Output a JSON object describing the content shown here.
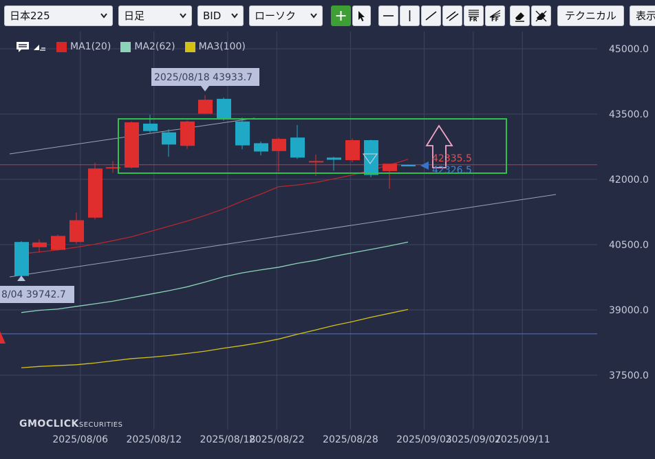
{
  "toolbar": {
    "symbol": "日本225",
    "timeframe": "日足",
    "price_type": "BID",
    "chart_style": "ローソク",
    "technical_label": "テクニカル",
    "display_label": "表示",
    "chevron": "⌄",
    "tool_icons": [
      "crosshair-icon",
      "pointer-icon",
      "horizontal-line-icon",
      "vertical-line-icon",
      "trend-line-icon",
      "parallel-lines-icon",
      "fibonacci-retracement-icon",
      "fibonacci-fan-icon",
      "eraser-icon",
      "eraser-all-icon"
    ],
    "fr_label": "FR",
    "ff_label": "FF",
    "active_tool": "crosshair-icon"
  },
  "legend": {
    "items": [
      {
        "label": "MA1(20)",
        "color": "#d72626"
      },
      {
        "label": "MA2(62)",
        "color": "#8bd4b8"
      },
      {
        "label": "MA3(100)",
        "color": "#d3c215"
      }
    ]
  },
  "brand": {
    "name": "GMOCLICK",
    "suffix": "SECURITIES"
  },
  "colors": {
    "background": "#262b44",
    "grid": "#3e4460",
    "bull": "#e02d2d",
    "bear": "#1fa9c6",
    "rectangle": "#2fc24a",
    "arrow": "#f0a8c8",
    "horizontal_line_red": "#c43a3a",
    "horizontal_line_blue": "#3a74c9",
    "trend_line": "#9ea3b5"
  },
  "chart_data": {
    "type": "candlestick",
    "y_ticks": [
      "45000.0",
      "43500.0",
      "42000.0",
      "40500.0",
      "39000.0",
      "37500.0"
    ],
    "x_ticks": [
      "2025/08/06",
      "2025/08/12",
      "2025/08/18",
      "2025/08/22",
      "2025/08/28",
      "2025/09/03",
      "2025/09/07",
      "2025/09/11"
    ],
    "ylim": [
      36900,
      45650
    ],
    "candles": [
      {
        "date": "2025/08/04",
        "open": 40560,
        "high": 40580,
        "low": 39742.7,
        "close": 39780
      },
      {
        "date": "2025/08/05",
        "open": 40440,
        "high": 40620,
        "low": 40320,
        "close": 40550
      },
      {
        "date": "2025/08/06",
        "open": 40380,
        "high": 40730,
        "low": 40370,
        "close": 40700
      },
      {
        "date": "2025/08/07",
        "open": 40560,
        "high": 41240,
        "low": 40520,
        "close": 41060
      },
      {
        "date": "2025/08/08",
        "open": 41120,
        "high": 42380,
        "low": 41080,
        "close": 42250
      },
      {
        "date": "2025/08/11",
        "open": 42280,
        "high": 42420,
        "low": 42150,
        "close": 42280
      },
      {
        "date": "2025/08/12",
        "open": 42270,
        "high": 43330,
        "low": 42250,
        "close": 43310
      },
      {
        "date": "2025/08/13",
        "open": 43280,
        "high": 43480,
        "low": 43070,
        "close": 43110
      },
      {
        "date": "2025/08/14",
        "open": 43080,
        "high": 43150,
        "low": 42520,
        "close": 42800
      },
      {
        "date": "2025/08/15",
        "open": 42770,
        "high": 43350,
        "low": 42700,
        "close": 43330
      },
      {
        "date": "2025/08/18",
        "open": 43510,
        "high": 43933.7,
        "low": 43500,
        "close": 43830
      },
      {
        "date": "2025/08/19",
        "open": 43850,
        "high": 43880,
        "low": 43350,
        "close": 43400
      },
      {
        "date": "2025/08/20",
        "open": 43330,
        "high": 43420,
        "low": 42690,
        "close": 42780
      },
      {
        "date": "2025/08/21",
        "open": 42830,
        "high": 42870,
        "low": 42550,
        "close": 42640
      },
      {
        "date": "2025/08/22",
        "open": 42650,
        "high": 42960,
        "low": 42180,
        "close": 42930
      },
      {
        "date": "2025/08/25",
        "open": 42960,
        "high": 43250,
        "low": 42470,
        "close": 42500
      },
      {
        "date": "2025/08/26",
        "open": 42420,
        "high": 42570,
        "low": 42080,
        "close": 42420
      },
      {
        "date": "2025/08/27",
        "open": 42500,
        "high": 42520,
        "low": 42200,
        "close": 42450
      },
      {
        "date": "2025/08/28",
        "open": 42440,
        "high": 42940,
        "low": 42390,
        "close": 42900
      },
      {
        "date": "2025/08/29",
        "open": 42900,
        "high": 42910,
        "low": 42050,
        "close": 42100
      },
      {
        "date": "2025/09/01",
        "open": 42190,
        "high": 42290,
        "low": 41780,
        "close": 42360
      },
      {
        "date": "2025/09/02",
        "open": 42330,
        "high": 42340,
        "low": 42300,
        "close": 42326.5
      }
    ],
    "series": [
      {
        "name": "MA1(20)",
        "color": "#b8262e",
        "values": [
          40290,
          40330,
          40380,
          40440,
          40510,
          40590,
          40680,
          40800,
          40920,
          41040,
          41170,
          41320,
          41500,
          41660,
          41830,
          41870,
          41930,
          42010,
          42100,
          42210,
          42330,
          42460
        ]
      },
      {
        "name": "MA2(62)",
        "color": "#8bd4b8",
        "values": [
          38940,
          38990,
          39020,
          39080,
          39140,
          39200,
          39280,
          39360,
          39440,
          39530,
          39640,
          39760,
          39850,
          39920,
          39980,
          40070,
          40140,
          40230,
          40310,
          40390,
          40470,
          40560
        ]
      },
      {
        "name": "MA3(100)",
        "color": "#d3c215",
        "values": [
          37670,
          37700,
          37720,
          37740,
          37780,
          37830,
          37880,
          37910,
          37950,
          38000,
          38050,
          38120,
          38180,
          38250,
          38330,
          38440,
          38540,
          38640,
          38730,
          38830,
          38920,
          39010
        ]
      }
    ],
    "annotations": {
      "high_label": "2025/08/18 43933.7",
      "low_label": "8/04 39742.7",
      "price_red": "42335.5",
      "price_blue": "42326.5",
      "hline_red": 42335.5,
      "hline_blue": 38450
    },
    "xlabel": "",
    "ylabel": ""
  }
}
